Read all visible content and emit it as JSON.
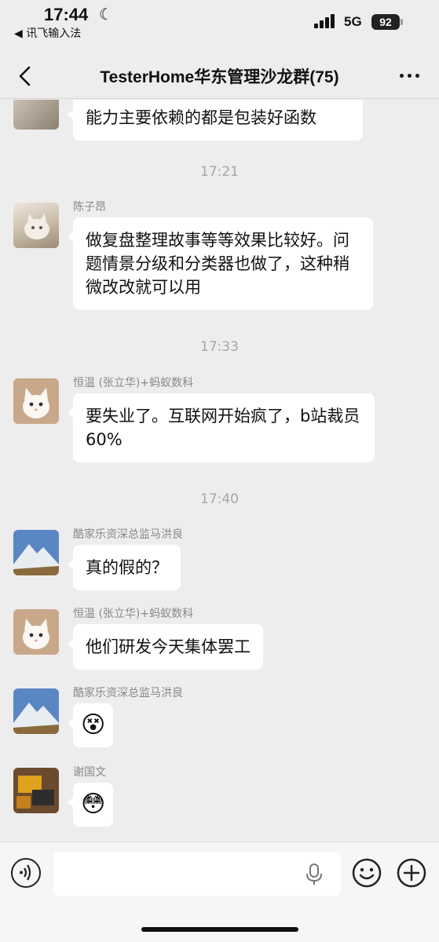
{
  "status": {
    "time": "17:44",
    "back_app": "◀ 讯飞输入法",
    "network": "5G",
    "battery": "92"
  },
  "nav": {
    "title": "TesterHome华东管理沙龙群(75)"
  },
  "messages": {
    "m0": {
      "text": "能力主要依赖的都是包装好函数"
    },
    "t1": "17:21",
    "m1": {
      "sender": "陈子昂",
      "text": "做复盘整理故事等等效果比较好。问题情景分级和分类器也做了，这种稍微改改就可以用"
    },
    "t2": "17:33",
    "m2": {
      "sender": "恒温 (张立华)+蚂蚁数科",
      "text": "要失业了。互联网开始疯了，b站裁员 60%"
    },
    "t3": "17:40",
    "m3": {
      "sender": "酷家乐资深总监马洪良",
      "text": "真的假的？"
    },
    "m4": {
      "sender": "恒温 (张立华)+蚂蚁数科",
      "text": "他们研发今天集体罢工"
    },
    "m5": {
      "sender": "酷家乐资深总监马洪良",
      "text": "😵"
    },
    "m6": {
      "sender": "谢国文",
      "text": "😳"
    }
  },
  "icons": {
    "back": "chevron-left-icon",
    "more": "more-dots-icon",
    "voice": "voice-icon",
    "mic": "mic-icon",
    "emoji": "emoji-icon",
    "plus": "plus-icon"
  },
  "colors": {
    "background": "#ededed",
    "bubble": "#ffffff",
    "muted": "#888888"
  }
}
